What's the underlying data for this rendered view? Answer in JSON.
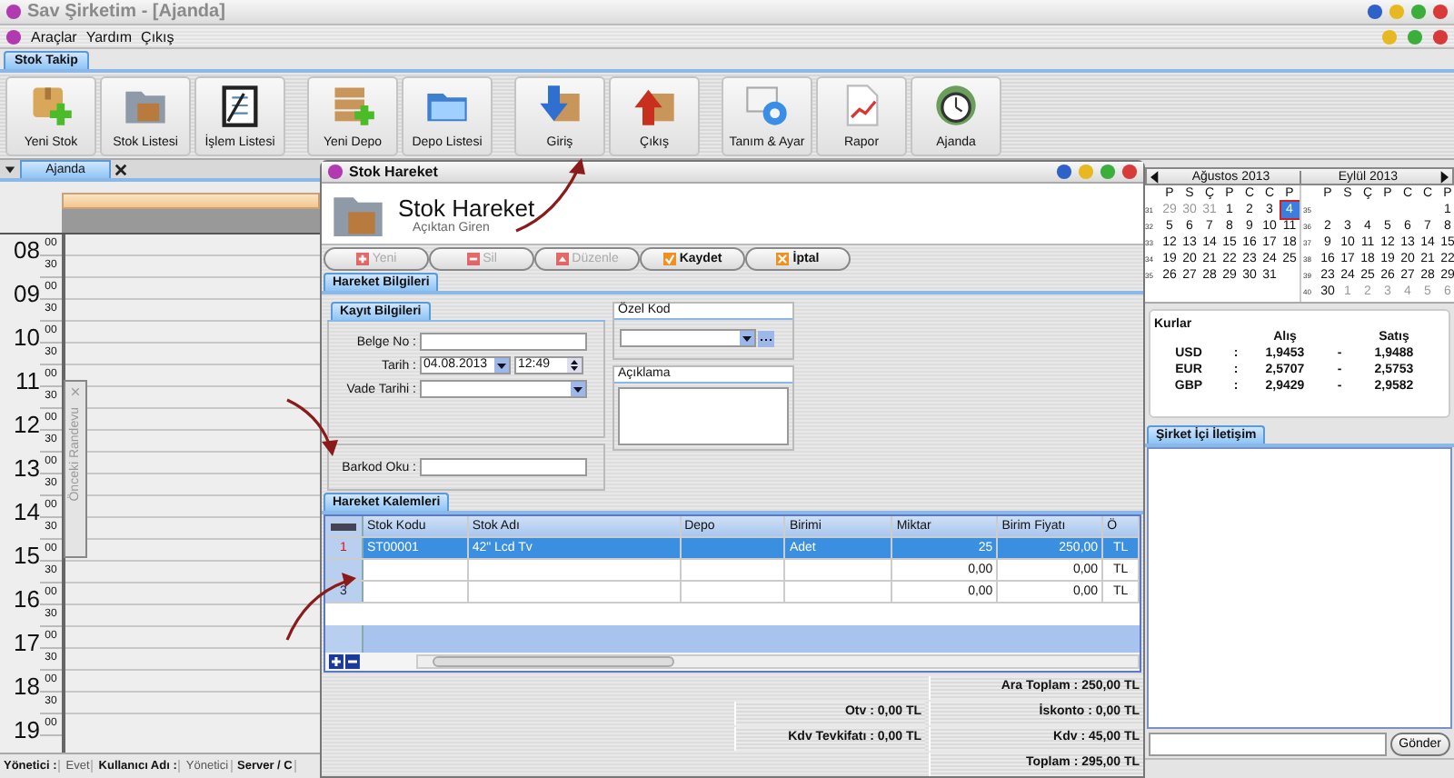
{
  "window": {
    "title": "Sav Şirketim - [Ajanda]"
  },
  "menu": [
    {
      "label": "Araçlar"
    },
    {
      "label": "Yardım"
    },
    {
      "label": "Çıkış"
    }
  ],
  "ribbon": {
    "tabs": [
      {
        "label": "Stok Takip",
        "selected": true
      }
    ],
    "groups": [
      [
        {
          "label": "Yeni Stok"
        },
        {
          "label": "Stok Listesi"
        },
        {
          "label": "İşlem Listesi"
        }
      ],
      [
        {
          "label": "Yeni Depo"
        },
        {
          "label": "Depo Listesi"
        }
      ],
      [
        {
          "label": "Giriş"
        },
        {
          "label": "Çıkış"
        }
      ],
      [
        {
          "label": "Tanım & Ayar"
        },
        {
          "label": "Rapor"
        },
        {
          "label": "Ajanda"
        }
      ]
    ]
  },
  "document_tabs": [
    {
      "label": "Ajanda",
      "selected": true
    }
  ],
  "agenda": {
    "hours": [
      {
        "hour": "08",
        "marks": [
          "00",
          "30"
        ]
      },
      {
        "hour": "09",
        "marks": [
          "00",
          "30"
        ]
      },
      {
        "hour": "10",
        "marks": [
          "00",
          "30"
        ]
      },
      {
        "hour": "11",
        "marks": [
          "00",
          "30"
        ]
      },
      {
        "hour": "12",
        "marks": [
          "00",
          "30"
        ]
      },
      {
        "hour": "13",
        "marks": [
          "00",
          "30"
        ]
      },
      {
        "hour": "14",
        "marks": [
          "00",
          "30"
        ]
      },
      {
        "hour": "15",
        "marks": [
          "00",
          "30"
        ]
      },
      {
        "hour": "16",
        "marks": [
          "00",
          "30"
        ]
      },
      {
        "hour": "17",
        "marks": [
          "00",
          "30"
        ]
      },
      {
        "hour": "18",
        "marks": [
          "00",
          "30"
        ]
      },
      {
        "hour": "19",
        "marks": [
          "00"
        ]
      }
    ],
    "side_panel": {
      "label": "Önceki Randevu"
    }
  },
  "status_bar": [
    {
      "text": "Yönetici :",
      "bold": true
    },
    {
      "text": "Evet",
      "bold": false
    },
    {
      "text": "Kullanıcı Adı :",
      "bold": true
    },
    {
      "text": "Yönetici",
      "bold": false
    },
    {
      "text": "Server / C",
      "bold": true
    }
  ],
  "dialog": {
    "title": "Stok Hareket",
    "header_title": "Stok Hareket",
    "header_subtitle": "Açıktan Giren",
    "actions": [
      {
        "label": "Yeni",
        "disabled": true
      },
      {
        "label": "Sil",
        "disabled": true
      },
      {
        "label": "Düzenle",
        "disabled": true
      },
      {
        "label": "Kaydet",
        "disabled": false
      },
      {
        "label": "İptal",
        "disabled": false
      }
    ],
    "tabs": [
      {
        "label": "Hareket Bilgileri",
        "selected": true
      }
    ],
    "form": {
      "group_tab": "Kayıt Bilgileri",
      "fields": [
        {
          "label": "Belge No :",
          "kind": "text"
        },
        {
          "label": "Tarih :",
          "kind": "datetime",
          "date": "04.08.2013",
          "time": "12:49"
        },
        {
          "label": "Vade Tarihi :",
          "kind": "combo"
        }
      ],
      "barcode": {
        "label": "Barkod Oku :"
      },
      "special_code": {
        "title": "Özel Kod"
      },
      "description": {
        "title": "Açıklama"
      }
    },
    "items_tabs": [
      {
        "label": "Hareket Kalemleri",
        "selected": true
      }
    ],
    "table": {
      "columns": [
        "Stok Kodu",
        "Stok Adı",
        "Depo",
        "Birimi",
        "Miktar",
        "Birim Fiyatı",
        "Ö"
      ],
      "rows": [
        {
          "number": "1",
          "selected": true,
          "cells": [
            "ST00001",
            "42\" Lcd Tv",
            null,
            "Adet",
            "25",
            "250,00",
            "TL"
          ]
        },
        {
          "selected": false,
          "cells": [
            null,
            null,
            null,
            null,
            "0,00",
            "0,00",
            "TL"
          ]
        },
        {
          "number": "3",
          "selected": false,
          "cells": [
            null,
            null,
            null,
            null,
            "0,00",
            "0,00",
            "TL"
          ]
        }
      ]
    },
    "totals": {
      "left": [
        "Otv : 0,00 TL",
        "Kdv Tevkifatı : 0,00 TL"
      ],
      "right": [
        "Ara Toplam : 250,00 TL",
        "İskonto : 0,00 TL",
        "Kdv : 45,00 TL",
        "Toplam : 295,00 TL"
      ]
    }
  },
  "calendar": {
    "months": [
      {
        "title": "Ağustos 2013",
        "weekdays": [
          "P",
          "S",
          "Ç",
          "P",
          "C",
          "C",
          "P"
        ],
        "weeks": [
          {
            "number": "31",
            "days": [
              {
                "label": "29",
                "other_month": true,
                "selected": false
              },
              {
                "label": "30",
                "other_month": true,
                "selected": false
              },
              {
                "label": "31",
                "other_month": true,
                "selected": false
              },
              {
                "label": "1",
                "other_month": false,
                "selected": false
              },
              {
                "label": "2",
                "other_month": false,
                "selected": false
              },
              {
                "label": "3",
                "other_month": false,
                "selected": false
              },
              {
                "label": "4",
                "other_month": false,
                "selected": true
              }
            ]
          },
          {
            "number": "32",
            "days": [
              {
                "label": "5",
                "other_month": false,
                "selected": false
              },
              {
                "label": "6",
                "other_month": false,
                "selected": false
              },
              {
                "label": "7",
                "other_month": false,
                "selected": false
              },
              {
                "label": "8",
                "other_month": false,
                "selected": false
              },
              {
                "label": "9",
                "other_month": false,
                "selected": false
              },
              {
                "label": "10",
                "other_month": false,
                "selected": false
              },
              {
                "label": "11",
                "other_month": false,
                "selected": false
              }
            ]
          },
          {
            "number": "33",
            "days": [
              {
                "label": "12",
                "other_month": false,
                "selected": false
              },
              {
                "label": "13",
                "other_month": false,
                "selected": false
              },
              {
                "label": "14",
                "other_month": false,
                "selected": false
              },
              {
                "label": "15",
                "other_month": false,
                "selected": false
              },
              {
                "label": "16",
                "other_month": false,
                "selected": false
              },
              {
                "label": "17",
                "other_month": false,
                "selected": false
              },
              {
                "label": "18",
                "other_month": false,
                "selected": false
              }
            ]
          },
          {
            "number": "34",
            "days": [
              {
                "label": "19",
                "other_month": false,
                "selected": false
              },
              {
                "label": "20",
                "other_month": false,
                "selected": false
              },
              {
                "label": "21",
                "other_month": false,
                "selected": false
              },
              {
                "label": "22",
                "other_month": false,
                "selected": false
              },
              {
                "label": "23",
                "other_month": false,
                "selected": false
              },
              {
                "label": "24",
                "other_month": false,
                "selected": false
              },
              {
                "label": "25",
                "other_month": false,
                "selected": false
              }
            ]
          },
          {
            "number": "35",
            "days": [
              {
                "label": "26",
                "other_month": false,
                "selected": false
              },
              {
                "label": "27",
                "other_month": false,
                "selected": false
              },
              {
                "label": "28",
                "other_month": false,
                "selected": false
              },
              {
                "label": "29",
                "other_month": false,
                "selected": false
              },
              {
                "label": "30",
                "other_month": false,
                "selected": false
              },
              {
                "label": "31",
                "other_month": false,
                "selected": false
              }
            ]
          }
        ]
      },
      {
        "title": "Eylül 2013",
        "weekdays": [
          "P",
          "S",
          "Ç",
          "P",
          "C",
          "C",
          "P"
        ],
        "weeks": [
          {
            "number": "35",
            "days": [
              {
                "label": "1",
                "other_month": false,
                "selected": false
              }
            ]
          },
          {
            "number": "36",
            "days": [
              {
                "label": "2",
                "other_month": false,
                "selected": false
              },
              {
                "label": "3",
                "other_month": false,
                "selected": false
              },
              {
                "label": "4",
                "other_month": false,
                "selected": false
              },
              {
                "label": "5",
                "other_month": false,
                "selected": false
              },
              {
                "label": "6",
                "other_month": false,
                "selected": false
              },
              {
                "label": "7",
                "other_month": false,
                "selected": false
              },
              {
                "label": "8",
                "other_month": false,
                "selected": false
              }
            ]
          },
          {
            "number": "37",
            "days": [
              {
                "label": "9",
                "other_month": false,
                "selected": false
              },
              {
                "label": "10",
                "other_month": false,
                "selected": false
              },
              {
                "label": "11",
                "other_month": false,
                "selected": false
              },
              {
                "label": "12",
                "other_month": false,
                "selected": false
              },
              {
                "label": "13",
                "other_month": false,
                "selected": false
              },
              {
                "label": "14",
                "other_month": false,
                "selected": false
              },
              {
                "label": "15",
                "other_month": false,
                "selected": false
              }
            ]
          },
          {
            "number": "38",
            "days": [
              {
                "label": "16",
                "other_month": false,
                "selected": false
              },
              {
                "label": "17",
                "other_month": false,
                "selected": false
              },
              {
                "label": "18",
                "other_month": false,
                "selected": false
              },
              {
                "label": "19",
                "other_month": false,
                "selected": false
              },
              {
                "label": "20",
                "other_month": false,
                "selected": false
              },
              {
                "label": "21",
                "other_month": false,
                "selected": false
              },
              {
                "label": "22",
                "other_month": false,
                "selected": false
              }
            ]
          },
          {
            "number": "39",
            "days": [
              {
                "label": "23",
                "other_month": false,
                "selected": false
              },
              {
                "label": "24",
                "other_month": false,
                "selected": false
              },
              {
                "label": "25",
                "other_month": false,
                "selected": false
              },
              {
                "label": "26",
                "other_month": false,
                "selected": false
              },
              {
                "label": "27",
                "other_month": false,
                "selected": false
              },
              {
                "label": "28",
                "other_month": false,
                "selected": false
              },
              {
                "label": "29",
                "other_month": false,
                "selected": false
              }
            ]
          },
          {
            "number": "40",
            "days": [
              {
                "label": "30",
                "other_month": false,
                "selected": false
              },
              {
                "label": "1",
                "other_month": true,
                "selected": false
              },
              {
                "label": "2",
                "other_month": true,
                "selected": false
              },
              {
                "label": "3",
                "other_month": true,
                "selected": false
              },
              {
                "label": "4",
                "other_month": true,
                "selected": false
              },
              {
                "label": "5",
                "other_month": true,
                "selected": false
              },
              {
                "label": "6",
                "other_month": true,
                "selected": false
              }
            ]
          }
        ]
      }
    ]
  },
  "rates": {
    "title": "Kurlar",
    "headers": [
      "Alış",
      "Satış"
    ],
    "rows": [
      {
        "code": "USD",
        "separator": ":",
        "buy": "1,9453",
        "dash": "-",
        "sell": "1,9488"
      },
      {
        "code": "EUR",
        "separator": ":",
        "buy": "2,5707",
        "dash": "-",
        "sell": "2,5753"
      },
      {
        "code": "GBP",
        "separator": ":",
        "buy": "2,9429",
        "dash": "-",
        "sell": "2,9582"
      }
    ]
  },
  "messaging": {
    "tabs": [
      {
        "label": "Şirket İçi İletişim",
        "selected": true
      }
    ],
    "send": "Gönder"
  }
}
